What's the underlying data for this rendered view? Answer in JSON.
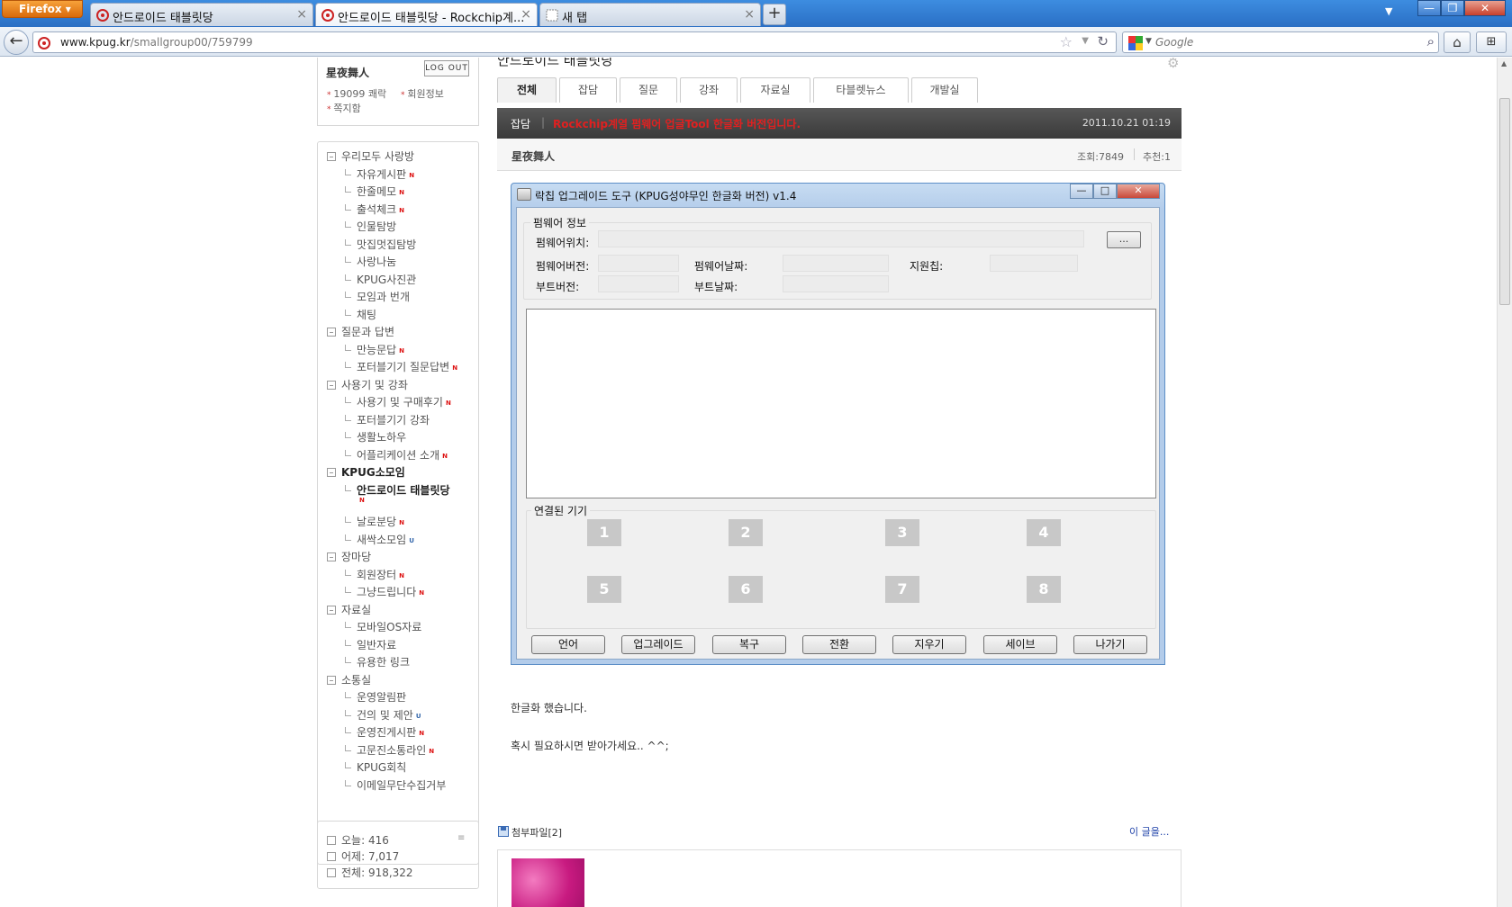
{
  "browser": {
    "firefox_label": "Firefox",
    "tabs": [
      {
        "title": "안드로이드 태블릿당",
        "close": "×"
      },
      {
        "title": "안드로이드 태블릿당 - Rockchip계...",
        "close": "×"
      },
      {
        "title": "새 탭",
        "close": "×"
      }
    ],
    "newtab": "+",
    "window_controls": {
      "minimize": "—",
      "restore": "❐",
      "close": "✕"
    },
    "url_host": "www.kpug.kr",
    "url_path": "/smallgroup00/759799",
    "search_placeholder": "Google"
  },
  "user": {
    "name": "星夜舞人",
    "logout": "LOG OUT",
    "links": [
      "19099 쾌락",
      "회원정보",
      "쪽지함"
    ]
  },
  "menu": [
    {
      "type": "cat",
      "label": "우리모두 사랑방"
    },
    {
      "type": "sub",
      "label": "자유게시판",
      "badge": "N"
    },
    {
      "type": "sub",
      "label": "한줄메모",
      "badge": "N"
    },
    {
      "type": "sub",
      "label": "출석체크",
      "badge": "N"
    },
    {
      "type": "sub",
      "label": "인물탐방"
    },
    {
      "type": "sub",
      "label": "맛집멋집탐방"
    },
    {
      "type": "sub",
      "label": "사랑나눔"
    },
    {
      "type": "sub",
      "label": "KPUG사진관"
    },
    {
      "type": "sub",
      "label": "모임과 번개"
    },
    {
      "type": "sub",
      "label": "채팅"
    },
    {
      "type": "cat",
      "label": "질문과 답변"
    },
    {
      "type": "sub",
      "label": "만능문답",
      "badge": "N"
    },
    {
      "type": "sub",
      "label": "포터블기기 질문답변",
      "badge": "N"
    },
    {
      "type": "cat",
      "label": "사용기 및 강좌"
    },
    {
      "type": "sub",
      "label": "사용기 및 구매후기",
      "badge": "N"
    },
    {
      "type": "sub",
      "label": "포터블기기 강좌"
    },
    {
      "type": "sub",
      "label": "생활노하우"
    },
    {
      "type": "sub",
      "label": "어플리케이션 소개",
      "badge": "N"
    },
    {
      "type": "cat",
      "label": "KPUG소모임",
      "bold": true
    },
    {
      "type": "sub",
      "label": "안드로이드 태블릿당",
      "bold": true,
      "badge_below": "N"
    },
    {
      "type": "sub",
      "label": "날로분당",
      "badge": "N"
    },
    {
      "type": "sub",
      "label": "새싹소모임",
      "badge_u": "U"
    },
    {
      "type": "cat",
      "label": "장마당"
    },
    {
      "type": "sub",
      "label": "회원장터",
      "badge": "N"
    },
    {
      "type": "sub",
      "label": "그냥드립니다",
      "badge": "N"
    },
    {
      "type": "cat",
      "label": "자료실"
    },
    {
      "type": "sub",
      "label": "모바일OS자료"
    },
    {
      "type": "sub",
      "label": "일반자료"
    },
    {
      "type": "sub",
      "label": "유용한 링크"
    },
    {
      "type": "cat",
      "label": "소통실"
    },
    {
      "type": "sub",
      "label": "운영알림판"
    },
    {
      "type": "sub",
      "label": "건의 및 제안",
      "badge_u": "U"
    },
    {
      "type": "sub",
      "label": "운영진게시판",
      "badge": "N"
    },
    {
      "type": "sub",
      "label": "고문진소통라인",
      "badge": "N"
    },
    {
      "type": "sub",
      "label": "KPUG회칙"
    },
    {
      "type": "sub",
      "label": "이메일무단수집거부"
    }
  ],
  "stats": {
    "today": "오늘: 416",
    "yesterday": "어제: 7,017",
    "total": "전체: 918,322",
    "more": "≡"
  },
  "board": {
    "title": "안드로이드 태블릿당",
    "tabs": [
      "전체",
      "잡담",
      "질문",
      "강좌",
      "자료실",
      "타블렛뉴스",
      "개발실"
    ],
    "active_tab": "전체"
  },
  "post": {
    "category": "잡담",
    "title": "Rockchip계열 펌웨어 업글Tool 한글화 버전입니다.",
    "date": "2011.10.21 01:19",
    "author": "星夜舞人",
    "views": "조회:7849",
    "recommend": "추천:1",
    "body_line1": "한글화 했습니다.",
    "body_line2": "혹시 필요하시면 받아가세요.. ^^;",
    "attach_label": "첨부파일[2]",
    "this_post_link": "이 글을..."
  },
  "app": {
    "title": "락칩 업그레이드 도구 (KPUG성야무인 한글화 버전) v1.4",
    "window_buttons": {
      "min": "—",
      "max": "□",
      "close": "✕"
    },
    "fw_group": "펌웨어 정보",
    "fw_path_label": "펌웨어위치:",
    "browse": "...",
    "fw_version_label": "펌웨어버전:",
    "fw_date_label": "펌웨어날짜:",
    "chip_label": "지원칩:",
    "boot_version_label": "부트버전:",
    "boot_date_label": "부트날짜:",
    "devices_group": "연결된 기기",
    "devices": [
      "1",
      "2",
      "3",
      "4",
      "5",
      "6",
      "7",
      "8"
    ],
    "buttons": [
      "언어",
      "업그레이드",
      "복구",
      "전환",
      "지우기",
      "세이브",
      "나가기"
    ]
  },
  "colors": {
    "post_header_bg": "#464646",
    "post_title": "#e02020",
    "new_badge": "#dd1111",
    "browser_chrome": "#2a6fc4"
  }
}
